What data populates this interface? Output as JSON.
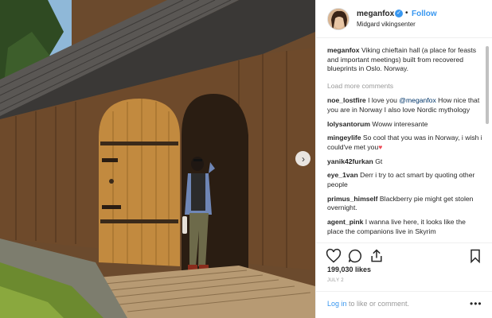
{
  "post": {
    "username": "meganfox",
    "follow_label": "Follow",
    "separator": "•",
    "location": "Midgard vikingsenter",
    "caption": {
      "user": "meganfox",
      "text": "Viking chieftain hall (a place for feasts and important meetings) built from recovered blueprints in Oslo. Norway."
    },
    "load_more": "Load more comments",
    "comments": [
      {
        "user": "noe_lostfire",
        "before": "I love you ",
        "mention": "@meganfox",
        "after": " How nice that you are in Norway I also love Nordic mythology"
      },
      {
        "user": "lolysantorum",
        "text": "Woww interesante"
      },
      {
        "user": "mingeylife",
        "text": "So cool that you was in Norway, i wish i could've met you",
        "heart": "♥"
      },
      {
        "user": "yanik42furkan",
        "text": "Gt"
      },
      {
        "user": "eye_1van",
        "text": "Derr i try to act smart by quoting other people"
      },
      {
        "user": "primus_himself",
        "text": "Blackberry pie might get stolen overnight."
      },
      {
        "user": "agent_pink",
        "text": "I wanna live here, it looks like the place the companions live in Skyrim"
      }
    ],
    "likes": "199,030 likes",
    "date": "JULY 2",
    "login_link": "Log in",
    "login_text": " to like or comment.",
    "more_label": "•••",
    "next_label": "›"
  },
  "icons": {
    "like": "heart-outline-icon",
    "comment": "speech-bubble-icon",
    "share": "share-icon",
    "save": "bookmark-icon",
    "verified": "verified-badge-icon",
    "next": "chevron-right-icon"
  },
  "colors": {
    "link": "#3897f0",
    "text": "#262626",
    "muted": "#999999",
    "heart": "#ed4956"
  }
}
